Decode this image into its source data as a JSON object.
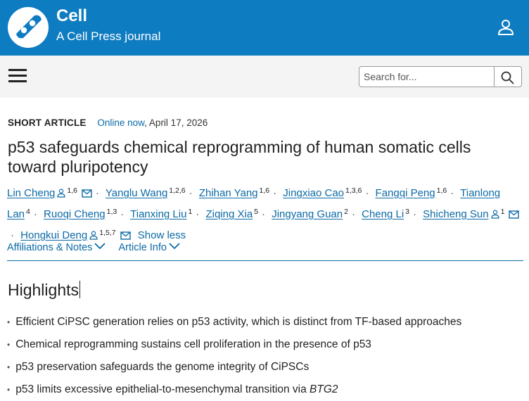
{
  "header": {
    "brand": "Cell",
    "tagline": "A Cell Press journal",
    "accent_color": "#0e7cc1",
    "icons": {
      "logo": "cell-logo-icon",
      "user": "user-icon"
    }
  },
  "nav": {
    "menu_icon": "hamburger-menu-icon",
    "search_placeholder": "Search for...",
    "search_icon": "search-icon"
  },
  "article": {
    "type": "SHORT ARTICLE",
    "online_label": "Online now",
    "date": ", April 17, 2026",
    "title": "p53 safeguards chemical reprogramming of human somatic cells toward pluripotency",
    "authors": [
      {
        "name": "Lin Cheng",
        "aff": "1,6",
        "person_icon": true,
        "mail_icon": true
      },
      {
        "name": "Yanglu Wang",
        "aff": "1,2,6"
      },
      {
        "name": "Zhihan Yang",
        "aff": "1,6"
      },
      {
        "name": "Jingxiao Cao",
        "aff": "1,3,6"
      },
      {
        "name": "Fangqi Peng",
        "aff": "1,6"
      },
      {
        "name": "Tianlong Lan",
        "aff": "4"
      },
      {
        "name": "Ruoqi Cheng",
        "aff": "1,3"
      },
      {
        "name": "Tianxing Liu",
        "aff": "1"
      },
      {
        "name": "Ziqing Xia",
        "aff": "5"
      },
      {
        "name": "Jingyang Guan",
        "aff": "2"
      },
      {
        "name": "Cheng Li",
        "aff": "3"
      },
      {
        "name": "Shicheng Sun",
        "aff": "1",
        "person_icon": true,
        "mail_icon": true
      },
      {
        "name": "Hongkui Deng",
        "aff": "1,5,7",
        "person_icon": true,
        "mail_icon": true
      }
    ],
    "separator": "·",
    "show_less": "Show less",
    "tabs": [
      "Affiliations & Notes",
      "Article Info"
    ],
    "highlights_heading": "Highlights",
    "highlights": [
      {
        "text": "Efficient CiPSC generation relies on p53 activity, which is distinct from TF-based approaches"
      },
      {
        "text": "Chemical reprogramming sustains cell proliferation in the presence of p53"
      },
      {
        "text": "p53 preservation safeguards the genome integrity of CiPSCs"
      },
      {
        "text": "p53 limits excessive epithelial-to-mesenchymal transition via ",
        "italic": "BTG2"
      }
    ]
  }
}
